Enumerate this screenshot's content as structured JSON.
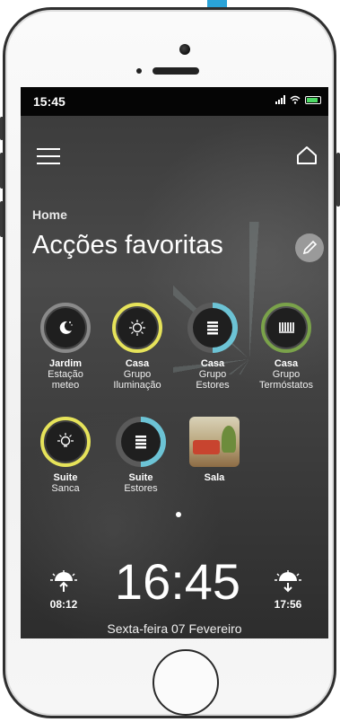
{
  "status_bar": {
    "time": "15:45"
  },
  "breadcrumb": "Home",
  "title": "Acções favoritas",
  "favorites": [
    {
      "name": "Jardim",
      "sub1": "Estação",
      "sub2": "meteo",
      "icon": "moon-icon",
      "ring_color": "#8a8a8a",
      "ring_fill": 1.0
    },
    {
      "name": "Casa",
      "sub1": "Grupo",
      "sub2": "Iluminação",
      "icon": "lightbulb-icon",
      "ring_color": "#e6e35a",
      "ring_fill": 1.0
    },
    {
      "name": "Casa",
      "sub1": "Grupo",
      "sub2": "Estores",
      "icon": "blinds-icon",
      "ring_color": "#6cc3d5",
      "ring_fill": 0.5
    },
    {
      "name": "Casa",
      "sub1": "Grupo",
      "sub2": "Termóstatos",
      "icon": "thermostat-icon",
      "ring_color": "#7aa24a",
      "ring_fill": 1.0
    },
    {
      "name": "Suite",
      "sub1": "Sanca",
      "sub2": "",
      "icon": "lightbulb-icon",
      "ring_color": "#e6e35a",
      "ring_fill": 1.0
    },
    {
      "name": "Suite",
      "sub1": "Estores",
      "sub2": "",
      "icon": "blinds-icon",
      "ring_color": "#6cc3d5",
      "ring_fill": 0.5
    },
    {
      "name": "Sala",
      "sub1": "",
      "sub2": "",
      "icon": "room-photo",
      "ring_color": "",
      "ring_fill": 0
    }
  ],
  "sunrise": "08:12",
  "sunset": "17:56",
  "clock": "16:45",
  "date": "Sexta-feira 07 Fevereiro"
}
